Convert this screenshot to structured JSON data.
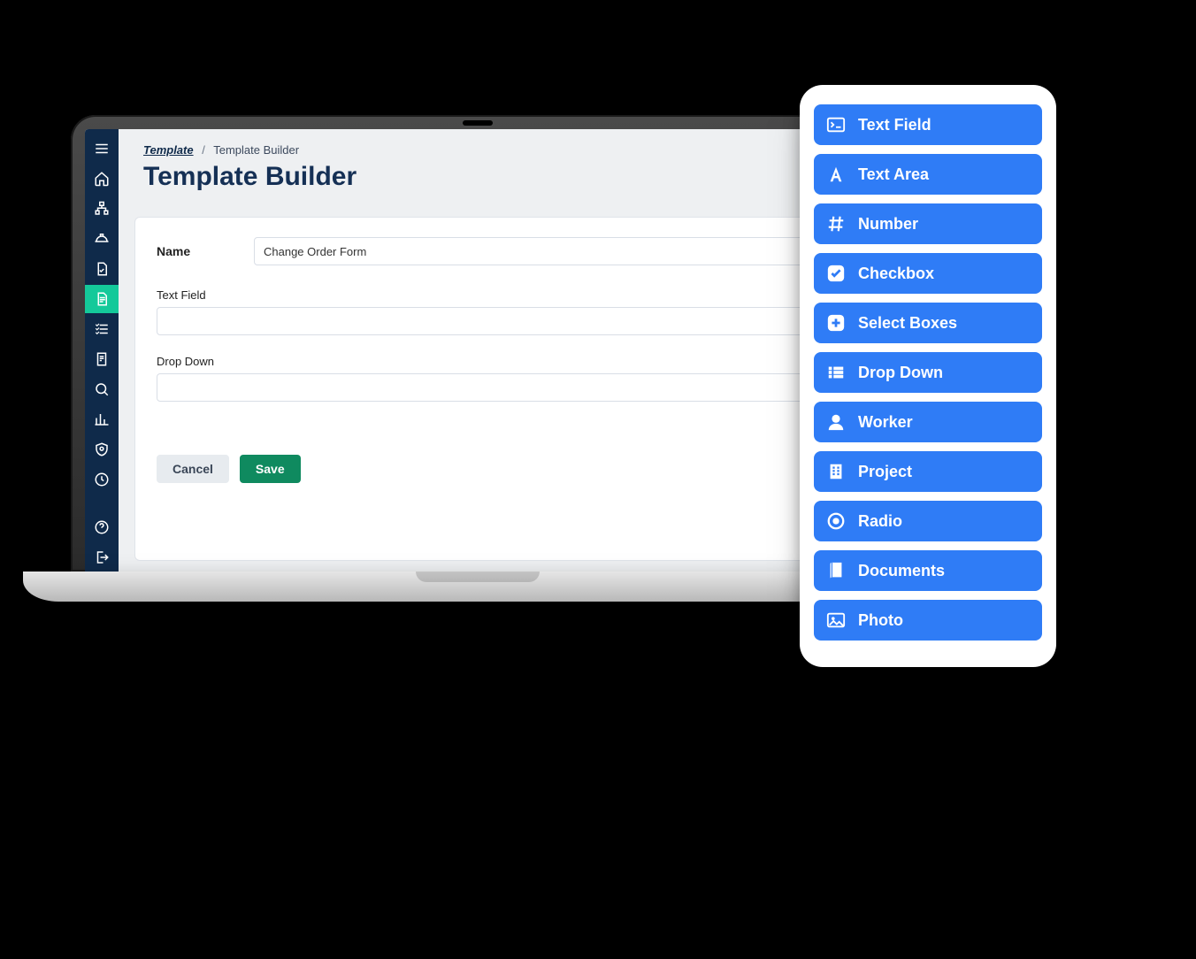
{
  "breadcrumb": {
    "root": "Template",
    "current": "Template Builder"
  },
  "page_title": "Template Builder",
  "form": {
    "name_label": "Name",
    "name_value": "Change Order Form",
    "fields": [
      {
        "label": "Text Field"
      },
      {
        "label": "Drop Down"
      }
    ],
    "cancel": "Cancel",
    "save": "Save"
  },
  "palette": [
    {
      "icon": "terminal",
      "label": "Text Field"
    },
    {
      "icon": "font",
      "label": "Text Area"
    },
    {
      "icon": "hash",
      "label": "Number"
    },
    {
      "icon": "check",
      "label": "Checkbox"
    },
    {
      "icon": "plusbox",
      "label": "Select Boxes"
    },
    {
      "icon": "list",
      "label": "Drop Down"
    },
    {
      "icon": "user",
      "label": "Worker"
    },
    {
      "icon": "building",
      "label": "Project"
    },
    {
      "icon": "radio",
      "label": "Radio"
    },
    {
      "icon": "book",
      "label": "Documents"
    },
    {
      "icon": "image",
      "label": "Photo"
    }
  ]
}
